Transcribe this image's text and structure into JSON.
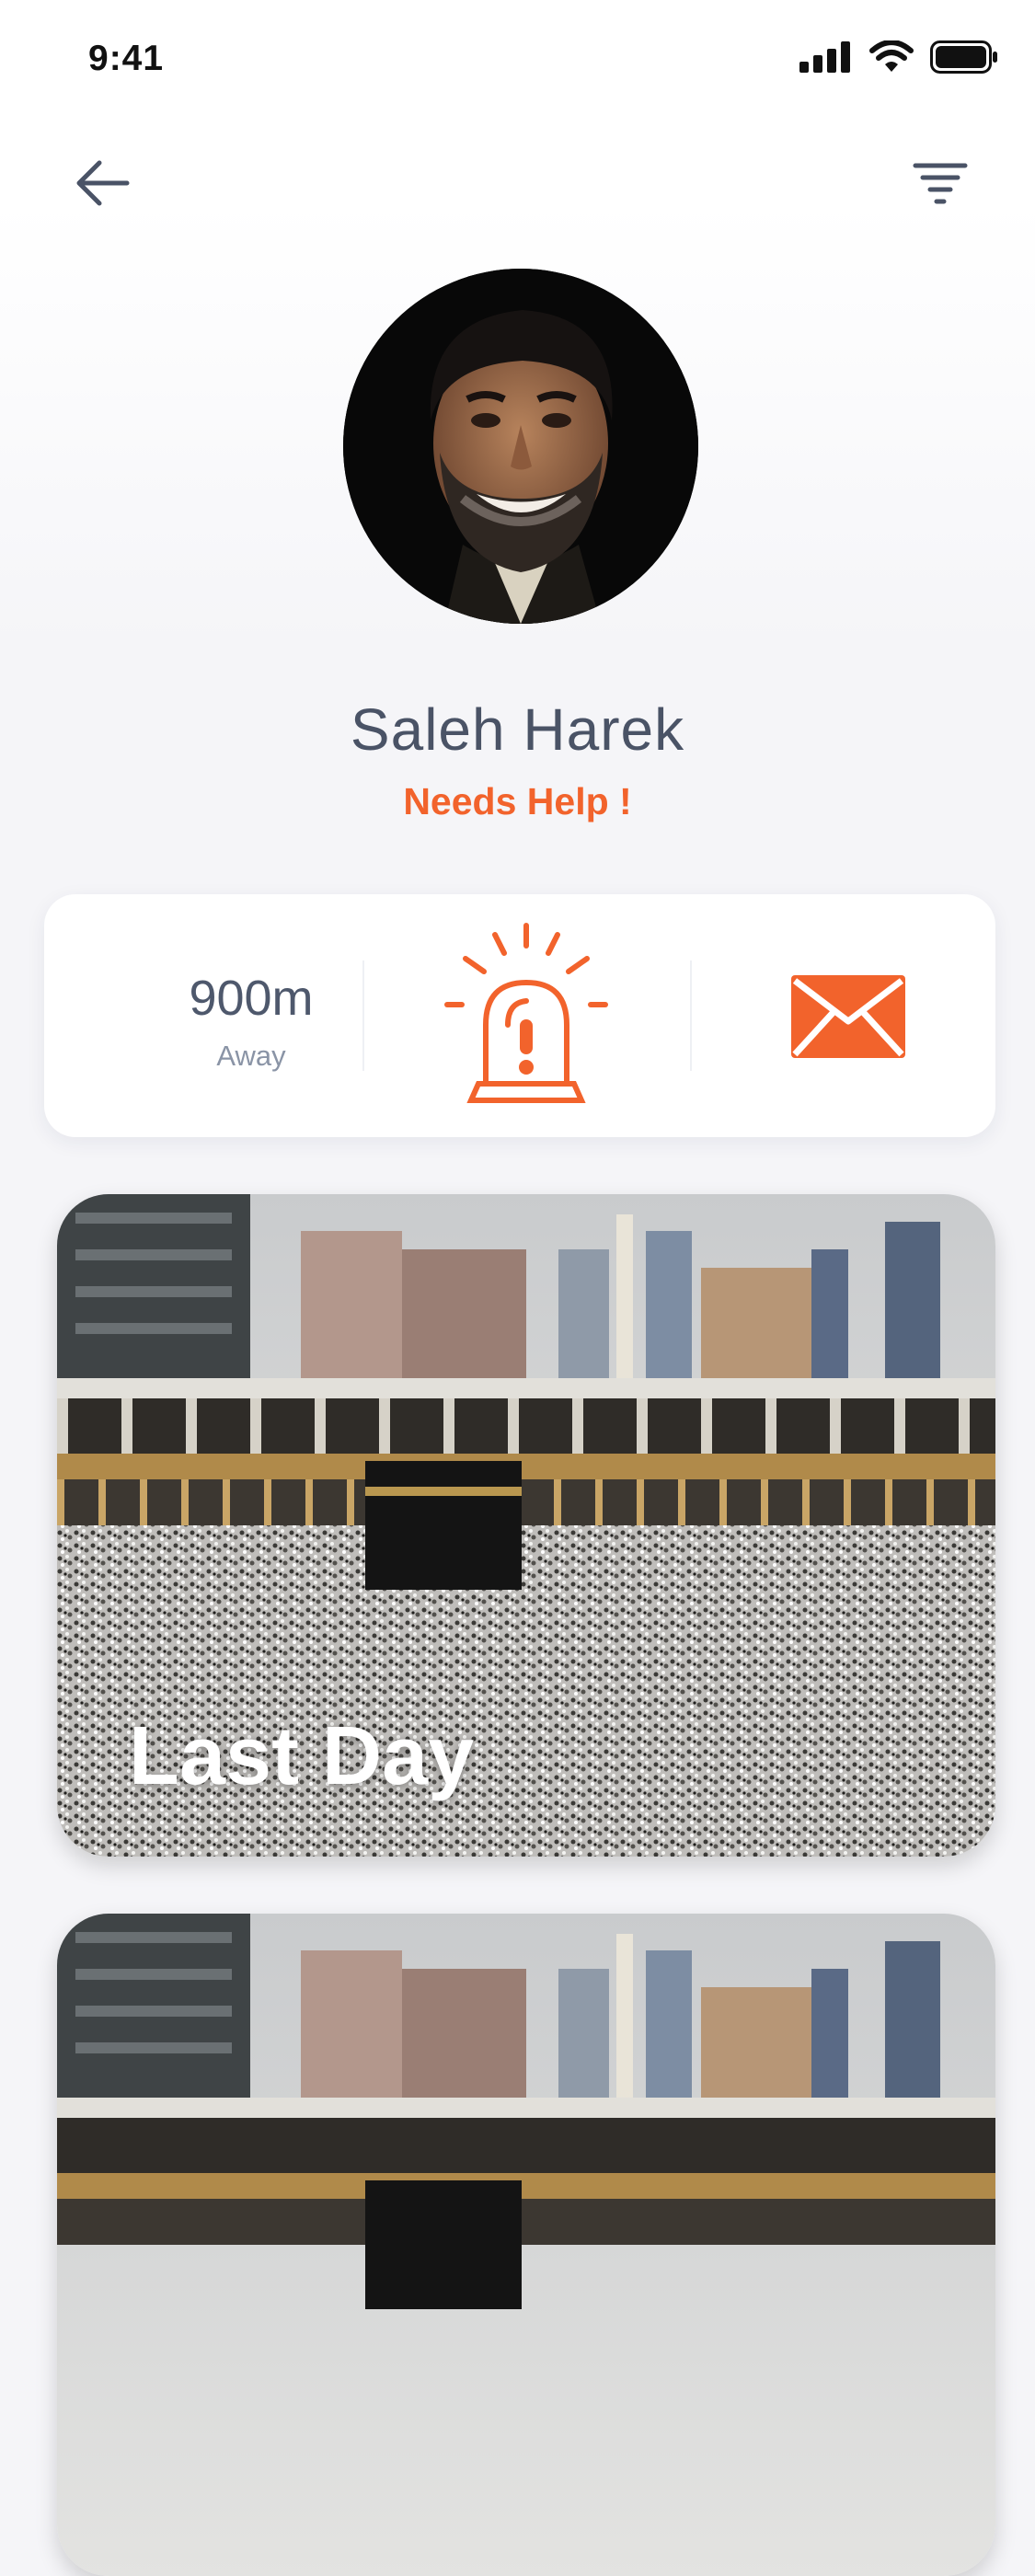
{
  "status_bar": {
    "time": "9:41"
  },
  "header": {
    "back_icon": "arrow-left-icon",
    "filter_icon": "filter-icon"
  },
  "profile": {
    "name": "Saleh Harek",
    "status": "Needs Help !"
  },
  "action_card": {
    "distance_value": "900m",
    "distance_unit": "Away",
    "alarm_icon": "siren-alert-icon",
    "message_icon": "envelope-icon"
  },
  "cards": [
    {
      "caption": "Last Day"
    },
    {
      "caption": ""
    }
  ],
  "colors": {
    "accent": "#f2632c",
    "text_primary": "#4a5366",
    "text_secondary": "#8a94a6",
    "background": "#f5f5f8"
  }
}
